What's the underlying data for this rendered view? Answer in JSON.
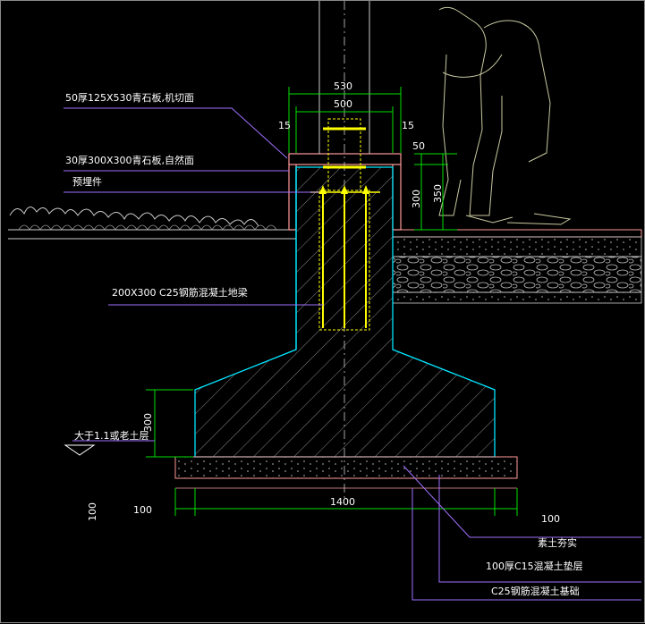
{
  "colors": {
    "background": "#000000",
    "concrete_outline": "#00e5ff",
    "leader_line": "#a070ff",
    "dimension_line": "#00e000",
    "stone_slab": "#ff9a9a",
    "rebar": "#ffff00",
    "figure_sketch": "#c8c8a0",
    "hatch": "#9a9a9a",
    "text": "#ffffff"
  },
  "labels": {
    "top_slab": "50厚125X530青石板,机切面",
    "side_slab": "30厚300X300青石板,自然面",
    "embedded_part": "预埋件",
    "beam": "200X300 C25钢筋混凝土地梁",
    "soil_layer": "大于1.1或老土层",
    "compacted_soil": "素土夯实",
    "cushion": "100厚C15混凝土垫层",
    "foundation": "C25钢筋混凝土基础"
  },
  "dimensions": {
    "top_width_outer": "530",
    "top_width_inner": "500",
    "side_left": "15",
    "side_right": "15",
    "slab_thickness": "50",
    "beam_height_300": "300",
    "beam_height_350": "350",
    "footing_height": "300",
    "base_width": "1400",
    "cushion_left": "100",
    "cushion_right": "100",
    "cushion_thickness": "100"
  }
}
